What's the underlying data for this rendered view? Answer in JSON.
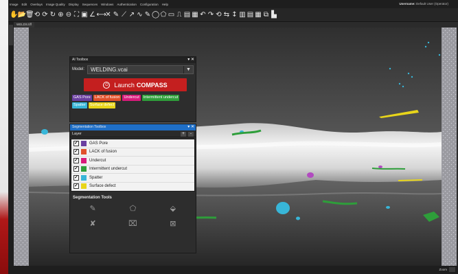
{
  "menu": [
    "Image",
    "Edit",
    "Overlays",
    "Image Quality",
    "Display",
    "Sequences",
    "Windows",
    "Authentication",
    "Configuration",
    "Help"
  ],
  "user": {
    "label": "Username:",
    "value": "Default User (Operator)"
  },
  "doc_tab": "WELDS.tiff",
  "status": {
    "zoom_label": "Zoom"
  },
  "toolbar_icons": [
    "hand-icon",
    "open-icon",
    "delete-icon",
    "prev-icon",
    "next-icon",
    "rotate-icon",
    "zoom-in-icon",
    "zoom-out-icon",
    "fit-icon",
    "image-icon",
    "angle-icon",
    "ruler-icon",
    "marker-icon",
    "pen-icon",
    "polyline-icon",
    "arrow-icon",
    "curve-icon",
    "annotation-icon",
    "ellipse-icon",
    "polygon-icon",
    "rectangle-icon",
    "line-profile-icon",
    "histogram-icon",
    "snapshot-icon",
    "undo-icon",
    "redo-icon",
    "reset-icon",
    "flip-icon",
    "invert-icon",
    "layout-icon",
    "overlay-icon",
    "grid-icon",
    "compare-icon",
    "chart-icon"
  ],
  "ai_toolbox": {
    "title": "AI Toolbox",
    "model_label": "Model:",
    "model_value": "WELDING.vcai",
    "launch_text": "Launch",
    "launch_bold": "COMPASS",
    "chips": [
      {
        "label": "GAS Pore",
        "color": "#6a3fa0"
      },
      {
        "label": "LACK of fusion",
        "color": "#e0502a"
      },
      {
        "label": "Undercut",
        "color": "#d81b7a"
      },
      {
        "label": "Intermittent undercut",
        "color": "#2e9e3a"
      },
      {
        "label": "Spatter",
        "color": "#38b6d8"
      },
      {
        "label": "Surface defect",
        "color": "#e8d51a"
      }
    ]
  },
  "segmentation": {
    "title": "Segmentation Toolbox",
    "layer_header": "Layer",
    "layers": [
      {
        "label": "GAS Pore",
        "color": "#6a3fa0",
        "checked": true
      },
      {
        "label": "LACK of fusion",
        "color": "#e0502a",
        "checked": true
      },
      {
        "label": "Undercut",
        "color": "#d81b7a",
        "checked": true
      },
      {
        "label": "Intermittent undercut",
        "color": "#2e9e3a",
        "checked": true
      },
      {
        "label": "Spatter",
        "color": "#38b6d8",
        "checked": true
      },
      {
        "label": "Surface defect",
        "color": "#e8d51a",
        "checked": true
      }
    ],
    "tools_title": "Segmentation Tools",
    "tools": [
      "brush-icon",
      "polygon-tool-icon",
      "fill-icon",
      "erase-brush-icon",
      "erase-polygon-icon",
      "erase-fill-icon"
    ]
  }
}
